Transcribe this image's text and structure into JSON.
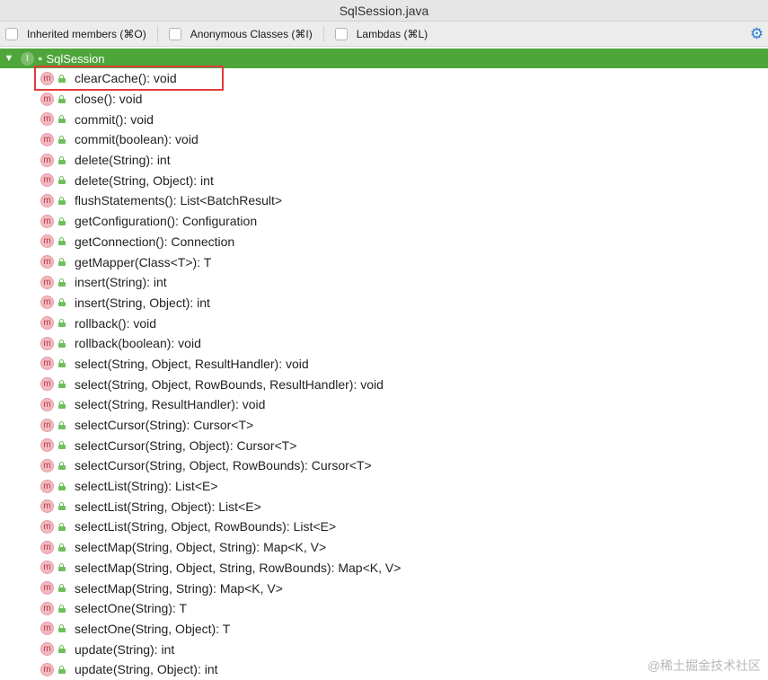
{
  "window": {
    "title": "SqlSession.java"
  },
  "options": [
    {
      "label": "Inherited members (⌘O)",
      "checked": false
    },
    {
      "label": "Anonymous Classes (⌘I)",
      "checked": false
    },
    {
      "label": "Lambdas (⌘L)",
      "checked": false
    }
  ],
  "tree": {
    "root_label": "SqlSession",
    "root_icon": "I",
    "method_icon": "m",
    "methods": [
      "clearCache(): void",
      "close(): void",
      "commit(): void",
      "commit(boolean): void",
      "delete(String): int",
      "delete(String, Object): int",
      "flushStatements(): List<BatchResult>",
      "getConfiguration(): Configuration",
      "getConnection(): Connection",
      "getMapper(Class<T>): T",
      "insert(String): int",
      "insert(String, Object): int",
      "rollback(): void",
      "rollback(boolean): void",
      "select(String, Object, ResultHandler): void",
      "select(String, Object, RowBounds, ResultHandler): void",
      "select(String, ResultHandler): void",
      "selectCursor(String): Cursor<T>",
      "selectCursor(String, Object): Cursor<T>",
      "selectCursor(String, Object, RowBounds): Cursor<T>",
      "selectList(String): List<E>",
      "selectList(String, Object): List<E>",
      "selectList(String, Object, RowBounds): List<E>",
      "selectMap(String, Object, String): Map<K, V>",
      "selectMap(String, Object, String, RowBounds): Map<K, V>",
      "selectMap(String, String): Map<K, V>",
      "selectOne(String): T",
      "selectOne(String, Object): T",
      "update(String): int",
      "update(String, Object): int"
    ]
  },
  "watermark": "@稀土掘金技术社区",
  "colors": {
    "root_row": "#4ea53a",
    "highlight": "#e23c3c",
    "gear": "#2f7fd6"
  }
}
